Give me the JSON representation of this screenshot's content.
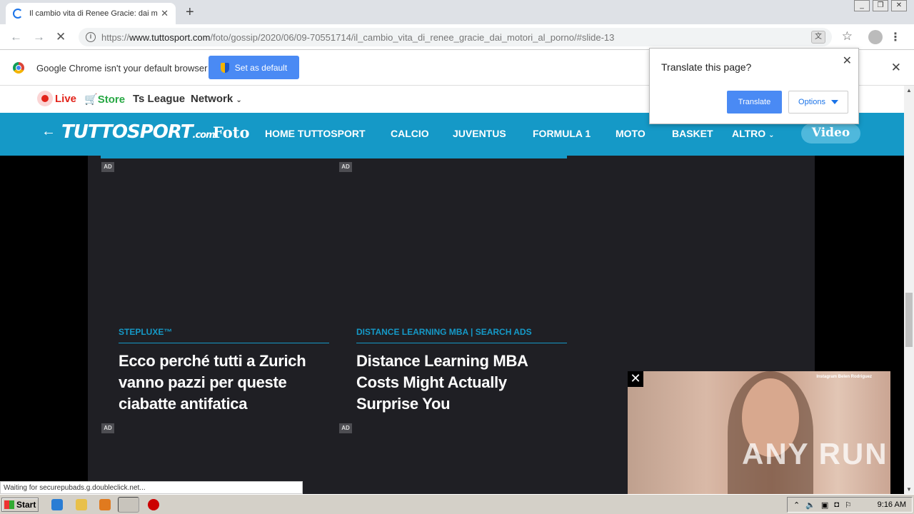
{
  "browser": {
    "tab_title": "Il cambio vita di Renee Gracie: dai m",
    "new_tab": "+",
    "url_scheme": "https://",
    "url_host": "www.tuttosport.com",
    "url_path": "/foto/gossip/2020/06/09-70551714/il_cambio_vita_di_renee_gracie_dai_motori_al_porno/#slide-13",
    "status_text": "Waiting for securepubads.g.doubleclick.net..."
  },
  "infobar": {
    "message": "Google Chrome isn't your default browser",
    "button_label": "Set as default"
  },
  "translate": {
    "question": "Translate this page?",
    "translate_label": "Translate",
    "options_label": "Options"
  },
  "site": {
    "live": "Live",
    "store": "Store",
    "league": "Ts League",
    "network": "Network",
    "logo": "TUTTOSPORT",
    "logo_suffix": ".com",
    "section": "Foto",
    "nav": [
      "HOME TUTTOSPORT",
      "CALCIO",
      "JUVENTUS",
      "FORMULA 1",
      "MOTO",
      "BASKET",
      "ALTRO"
    ],
    "video": "Video"
  },
  "cards": [
    {
      "source": "STEPLUXE™",
      "title": "Ecco perché tutti a Zurich vanno pazzi per queste ciabatte antifatica",
      "ad": "AD"
    },
    {
      "source": "DISTANCE LEARNING MBA | SEARCH ADS",
      "title": "Distance Learning MBA Costs Might Actually Surprise You",
      "ad": "AD"
    }
  ],
  "ad_label": "AD",
  "video_ad": {
    "caption": "Instagram Belen Rodriguez",
    "watermark": "ANY RUN"
  },
  "taskbar": {
    "start": "Start",
    "clock": "9:16 AM"
  }
}
